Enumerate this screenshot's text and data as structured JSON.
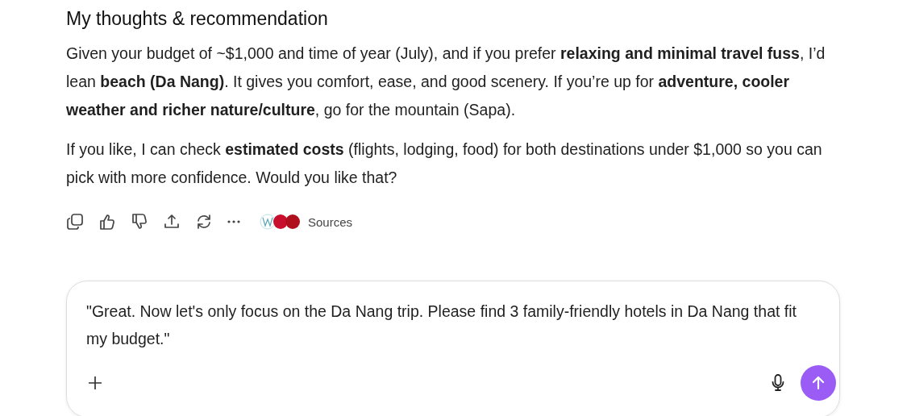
{
  "heading": "My thoughts & recommendation",
  "paragraphs": [
    "Given your budget of ~$1,000 and time of year (July), and if you prefer **relaxing and minimal travel fuss**, I’d lean **beach (Da Nang)**. It gives you comfort, ease, and good scenery. If you’re up for **adventure, cooler weather and richer nature/culture**, go for the mountain (Sapa).",
    "If you like, I can check **estimated costs** (flights, lodging, food) for both destinations under $1,000 so you can pick with more confidence. Would you like that?"
  ],
  "actions": [
    {
      "kind": "copy"
    },
    {
      "kind": "like"
    },
    {
      "kind": "dislike"
    },
    {
      "kind": "share"
    },
    {
      "kind": "retry"
    },
    {
      "kind": "more"
    }
  ],
  "sources": {
    "label": "Sources"
  },
  "composer": {
    "value": "\"Great. Now let's only focus on the Da Nang trip. Please find 3 family-friendly hotels in Da Nang that fit my budget.\""
  }
}
